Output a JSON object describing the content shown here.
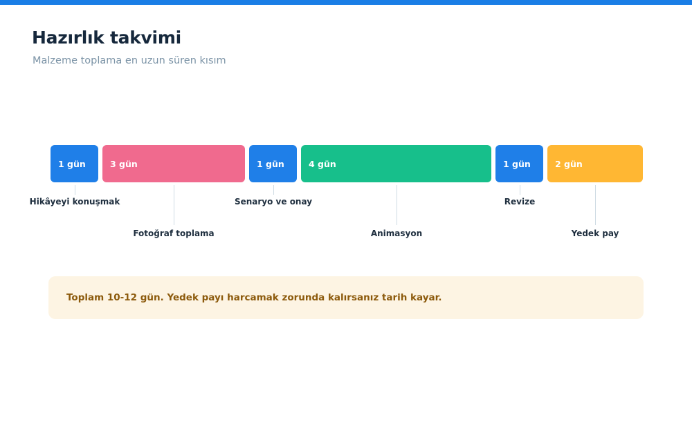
{
  "header": {
    "title": "Hazırlık takvimi",
    "subtitle": "Malzeme toplama en uzun süren kısım"
  },
  "segments": [
    {
      "duration": "1 gün",
      "label": "Hikâyeyi konuşmak",
      "color": "#1f7fe8",
      "label_row": 1
    },
    {
      "duration": "3 gün",
      "label": "Fotoğraf toplama",
      "color": "#f06a8e",
      "label_row": 2
    },
    {
      "duration": "1 gün",
      "label": "Senaryo ve onay",
      "color": "#1f7fe8",
      "label_row": 1
    },
    {
      "duration": "4 gün",
      "label": "Animasyon",
      "color": "#17bf8b",
      "label_row": 2
    },
    {
      "duration": "1 gün",
      "label": "Revize",
      "color": "#1f7fe8",
      "label_row": 1
    },
    {
      "duration": "2 gün",
      "label": "Yedek pay",
      "color": "#ffb733",
      "label_row": 2
    }
  ],
  "note": {
    "text": "Toplam 10-12 gün. Yedek payı harcamak zorunda kalırsanız tarih kayar."
  }
}
